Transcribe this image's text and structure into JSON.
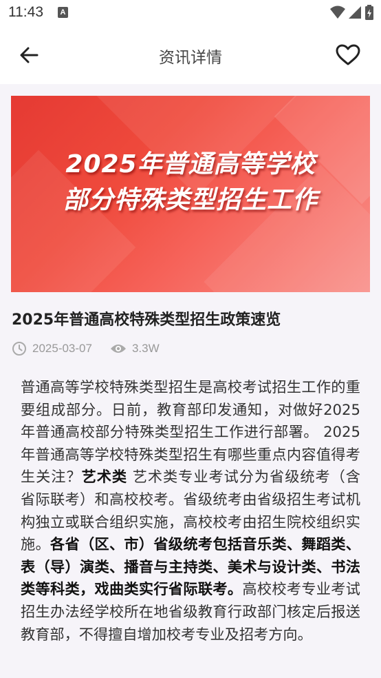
{
  "status": {
    "time": "11:43",
    "notification_letter": "A"
  },
  "header": {
    "title": "资讯详情"
  },
  "banner": {
    "line1": "2025年普通高等学校",
    "line2": "部分特殊类型招生工作"
  },
  "article": {
    "title": "2025年普通高校特殊类型招生政策速览",
    "date": "2025-03-07",
    "views": "3.3W",
    "p1": "普通高等学校特殊类型招生是高校考试招生工作的重要组成部分。日前，教育部印发通知，对做好2025年普通高校部分特殊类型招生工作进行部署。 2025年普通高等学校特殊类型招生有哪些重点内容值得考生关注？",
    "b1": "艺术类",
    "p2": " 艺术类专业考试分为省级统考（含省际联考）和高校校考。省级统考由省级招生考试机构独立或联合组织实施，高校校考由招生院校组织实施。",
    "b2": "各省（区、市）省级统考包括音乐类、舞蹈类、表（导）演类、播音与主持类、美术与设计类、书法类等科类，戏曲类实行省际联考。",
    "p3": "高校校考专业考试招生办法经学校所在地省级教育行政部门核定后报送教育部，不得擅自增加校考专业及招考方向。"
  }
}
